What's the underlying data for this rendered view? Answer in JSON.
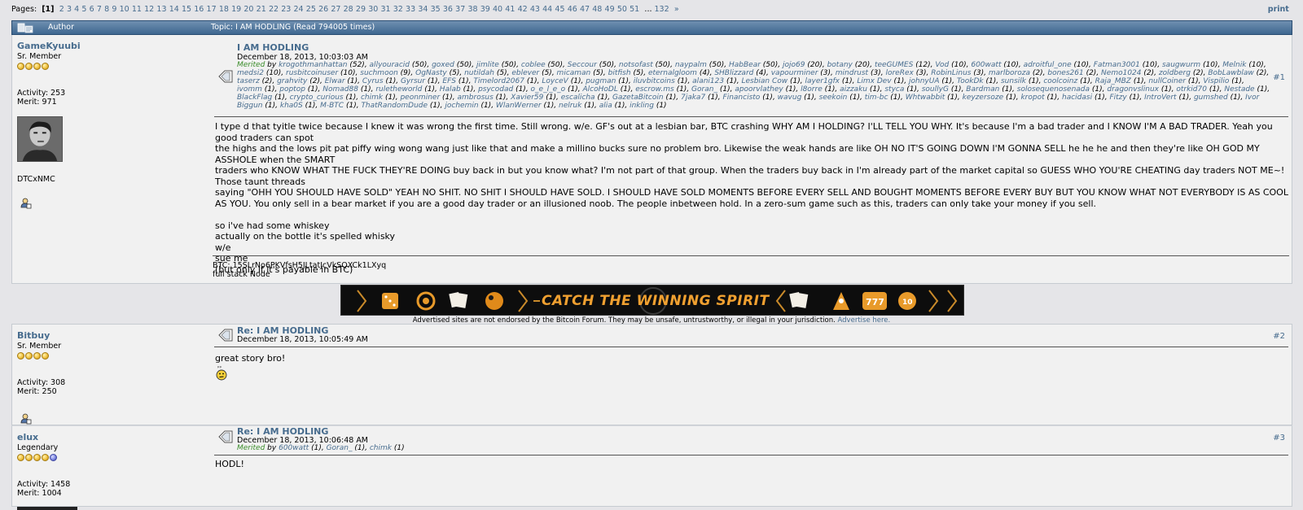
{
  "pagination": {
    "label": "Pages:",
    "current": "[1]",
    "pages": [
      "2",
      "3",
      "4",
      "5",
      "6",
      "7",
      "8",
      "9",
      "10",
      "11",
      "12",
      "13",
      "14",
      "15",
      "16",
      "17",
      "18",
      "19",
      "20",
      "21",
      "22",
      "23",
      "24",
      "25",
      "26",
      "27",
      "28",
      "29",
      "30",
      "31",
      "32",
      "33",
      "34",
      "35",
      "36",
      "37",
      "38",
      "39",
      "40",
      "41",
      "42",
      "43",
      "44",
      "45",
      "46",
      "47",
      "48",
      "49",
      "50",
      "51"
    ],
    "ellipsis": "...",
    "last": "132",
    "next": "»",
    "print": "print"
  },
  "header": {
    "author_label": "Author",
    "topic_label": "Topic: I AM HODLING  (Read 794005 times)"
  },
  "posts": [
    {
      "username": "GameKyuubi",
      "rank": "Sr. Member",
      "stars": 4,
      "activity": "Activity: 253",
      "merit": "Merit: 971",
      "signature_name": "DTCxNMC",
      "subject": "I AM HODLING",
      "date": "December 18, 2013, 10:03:03 AM",
      "number": "#1",
      "merited_label": "Merited",
      "merited_by": "by",
      "merits": [
        [
          "krogothmanhattan",
          "(52)"
        ],
        [
          "allyouracid",
          "(50)"
        ],
        [
          "goxed",
          "(50)"
        ],
        [
          "jimlite",
          "(50)"
        ],
        [
          "coblee",
          "(50)"
        ],
        [
          "Seccour",
          "(50)"
        ],
        [
          "notsofast",
          "(50)"
        ],
        [
          "naypalm",
          "(50)"
        ],
        [
          "HabBear",
          "(50)"
        ],
        [
          "jojo69",
          "(20)"
        ],
        [
          "botany",
          "(20)"
        ],
        [
          "teeGUMES",
          "(12)"
        ],
        [
          "Vod",
          "(10)"
        ],
        [
          "600watt",
          "(10)"
        ],
        [
          "adroitful_one",
          "(10)"
        ],
        [
          "Fatman3001",
          "(10)"
        ],
        [
          "saugwurm",
          "(10)"
        ],
        [
          "Melnik",
          "(10)"
        ],
        [
          "medsi2",
          "(10)"
        ],
        [
          "rusbitcoinuser",
          "(10)"
        ],
        [
          "suchmoon",
          "(9)"
        ],
        [
          "OgNasty",
          "(5)"
        ],
        [
          "nutildah",
          "(5)"
        ],
        [
          "eblever",
          "(5)"
        ],
        [
          "micaman",
          "(5)"
        ],
        [
          "bitfish",
          "(5)"
        ],
        [
          "eternalgloom",
          "(4)"
        ],
        [
          "SHBlizzard",
          "(4)"
        ],
        [
          "vapourminer",
          "(3)"
        ],
        [
          "mindrust",
          "(3)"
        ],
        [
          "loreRex",
          "(3)"
        ],
        [
          "RobinLinus",
          "(3)"
        ],
        [
          "marlboroza",
          "(2)"
        ],
        [
          "bones261",
          "(2)"
        ],
        [
          "Nemo1024",
          "(2)"
        ],
        [
          "zoldberg",
          "(2)"
        ],
        [
          "BobLawblaw",
          "(2)"
        ],
        [
          "taserz",
          "(2)"
        ],
        [
          "grahvity",
          "(2)"
        ],
        [
          "Elwar",
          "(1)"
        ],
        [
          "Cyrus",
          "(1)"
        ],
        [
          "Gyrsur",
          "(1)"
        ],
        [
          "EFS",
          "(1)"
        ],
        [
          "Timelord2067",
          "(1)"
        ],
        [
          "LoyceV",
          "(1)"
        ],
        [
          "pugman",
          "(1)"
        ],
        [
          "iluvbitcoins",
          "(1)"
        ],
        [
          "alani123",
          "(1)"
        ],
        [
          "Lesbian Cow",
          "(1)"
        ],
        [
          "layer1gfx",
          "(1)"
        ],
        [
          "Limx Dev",
          "(1)"
        ],
        [
          "johnyUA",
          "(1)"
        ],
        [
          "TookDk",
          "(1)"
        ],
        [
          "sunsilk",
          "(1)"
        ],
        [
          "coolcoinz",
          "(1)"
        ],
        [
          "Raja_MBZ",
          "(1)"
        ],
        [
          "nullCoiner",
          "(1)"
        ],
        [
          "Vispilio",
          "(1)"
        ],
        [
          "ivomm",
          "(1)"
        ],
        [
          "poptop",
          "(1)"
        ],
        [
          "Nomad88",
          "(1)"
        ],
        [
          "ruletheworld",
          "(1)"
        ],
        [
          "Halab",
          "(1)"
        ],
        [
          "psycodad",
          "(1)"
        ],
        [
          "o_e_l_e_o",
          "(1)"
        ],
        [
          "AlcoHoDL",
          "(1)"
        ],
        [
          "escrow.ms",
          "(1)"
        ],
        [
          "Goran_",
          "(1)"
        ],
        [
          "apoorvlathey",
          "(1)"
        ],
        [
          "l8orre",
          "(1)"
        ],
        [
          "aizzaku",
          "(1)"
        ],
        [
          "styca",
          "(1)"
        ],
        [
          "soullyG",
          "(1)"
        ],
        [
          "Bardman",
          "(1)"
        ],
        [
          "solosequenosenada",
          "(1)"
        ],
        [
          "dragonvslinux",
          "(1)"
        ],
        [
          "otrkid70",
          "(1)"
        ],
        [
          "Nestade",
          "(1)"
        ],
        [
          "BlackFlag",
          "(1)"
        ],
        [
          "crypto_curious",
          "(1)"
        ],
        [
          "chimk",
          "(1)"
        ],
        [
          "peonminer",
          "(1)"
        ],
        [
          "ambrosus",
          "(1)"
        ],
        [
          "Xavier59",
          "(1)"
        ],
        [
          "escalicha",
          "(1)"
        ],
        [
          "GazetaBitcoin",
          "(1)"
        ],
        [
          "7jaka7",
          "(1)"
        ],
        [
          "Financisto",
          "(1)"
        ],
        [
          "wavug",
          "(1)"
        ],
        [
          "seekoin",
          "(1)"
        ],
        [
          "tim-bc",
          "(1)"
        ],
        [
          "Whtwabbit",
          "(1)"
        ],
        [
          "keyzersoze",
          "(1)"
        ],
        [
          "kropot",
          "(1)"
        ],
        [
          "hacidasi",
          "(1)"
        ],
        [
          "Fitzy",
          "(1)"
        ],
        [
          "IntroVert",
          "(1)"
        ],
        [
          "gumshed",
          "(1)"
        ],
        [
          "Ivor Biggun",
          "(1)"
        ],
        [
          "kha0S",
          "(1)"
        ],
        [
          "M-BTC",
          "(1)"
        ],
        [
          "ThatRandomDude",
          "(1)"
        ],
        [
          "jochemin",
          "(1)"
        ],
        [
          "WlanWerner",
          "(1)"
        ],
        [
          "nelruk",
          "(1)"
        ],
        [
          "alia",
          "(1)"
        ],
        [
          "inkling",
          "(1)"
        ]
      ],
      "body_lines": [
        "I type d that tyitle twice because I knew it was wrong the first time.  Still wrong.  w/e.  GF's out at a lesbian bar, BTC crashing WHY AM I HOLDING? I'LL TELL YOU WHY.  It's because I'm a bad trader and I KNOW I'M A BAD TRADER.  Yeah you good traders can spot",
        "the highs and the lows pit pat piffy wing wong wang just like that and make a millino bucks sure no problem bro.  Likewise the weak hands are like OH NO IT'S GOING DOWN I'M GONNA SELL he he he and then they're like OH GOD MY ASSHOLE when the SMART",
        "traders who KNOW WHAT THE FUCK THEY'RE DOING buy back in but you know what?  I'm not part of that group.  When the traders buy back in I'm already part of the market capital so GUESS WHO YOU'RE CHEATING day traders NOT ME~!  Those taunt threads",
        "saying \"OHH YOU SHOULD HAVE SOLD\" YEAH NO SHIT.  NO SHIT I SHOULD HAVE SOLD.  I SHOULD HAVE SOLD MOMENTS BEFORE EVERY SELL AND BOUGHT MOMENTS BEFORE EVERY BUY BUT YOU KNOW WHAT NOT EVERYBODY IS AS COOL",
        "AS YOU.  You only sell in a bear market if you are a good day trader or an illusioned noob.  The people inbetween hold.  In a zero-sum game such as this, traders can only take your money if you sell.",
        "",
        "so i've had some whiskey",
        "actually on the bottle it's spelled whisky",
        "w/e",
        "sue me",
        "(but only if it's payable in BTC)"
      ],
      "sig_lines": [
        "BTC: 15SLrNo6PKVfsH5JLtatJcVkSQXCk1LXyq",
        "full stack Node"
      ]
    },
    {
      "username": "Bitbuy",
      "rank": "Sr. Member",
      "stars": 4,
      "activity": "Activity: 308",
      "merit": "Merit: 250",
      "subject": "Re: I AM HODLING",
      "date": "December 18, 2013, 10:05:49 AM",
      "number": "#2",
      "body": "great story bro!"
    },
    {
      "username": "elux",
      "rank": "Legendary",
      "stars": 5,
      "activity": "Activity: 1458",
      "merit": "Merit: 1004",
      "subject": "Re: I AM HODLING",
      "date": "December 18, 2013, 10:06:48 AM",
      "number": "#3",
      "merited_label": "Merited",
      "merited_by": "by",
      "merits": [
        [
          "600watt",
          "(1)"
        ],
        [
          "Goran_",
          "(1)"
        ],
        [
          "chimk",
          "(1)"
        ]
      ],
      "body": "HODL!"
    }
  ],
  "banner": {
    "text": "CATCH THE WINNING SPIRIT"
  },
  "disclaimer": {
    "text": "Advertised sites are not endorsed by the Bitcoin Forum. They may be unsafe, untrustworthy, or illegal in your jurisdiction.",
    "link": "Advertise here."
  },
  "icons": {
    "header": "topic-icon",
    "post": "message-icon",
    "profile": "profile-icon",
    "smiley": "drunk-smiley-icon"
  },
  "colors": {
    "link": "#476c8e",
    "merited": "#3a8d2a",
    "header_bg": "#476c8e",
    "post_bg": "#f1f1f1",
    "banner_text": "#f0a030"
  }
}
